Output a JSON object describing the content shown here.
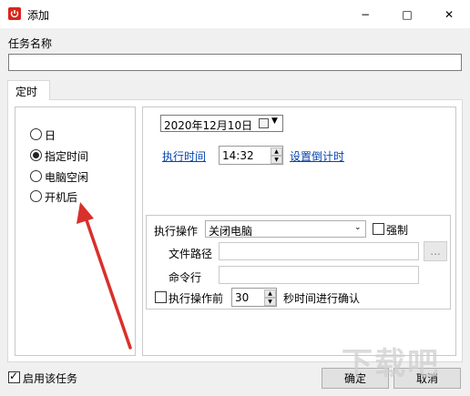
{
  "window": {
    "title": "添加",
    "controls": {
      "minimize": "−",
      "maximize": "□",
      "close": "✕"
    }
  },
  "task_name": {
    "label": "任务名称",
    "value": ""
  },
  "tab": {
    "label": "定时"
  },
  "schedule_options": [
    {
      "label": "日",
      "selected": false
    },
    {
      "label": "指定时间",
      "selected": true
    },
    {
      "label": "电脑空闲",
      "selected": false
    },
    {
      "label": "开机后",
      "selected": false
    }
  ],
  "date_picker": {
    "value": "2020年12月10日"
  },
  "exec_time": {
    "link": "执行时间",
    "value": "14:32",
    "countdown_link": "设置倒计时"
  },
  "action": {
    "label": "执行操作",
    "value": "关闭电脑",
    "force_label": "强制"
  },
  "file_path": {
    "label": "文件路径",
    "value": "",
    "browse": "..."
  },
  "command": {
    "label": "命令行",
    "value": ""
  },
  "confirm": {
    "label": "执行操作前",
    "seconds": "30",
    "suffix": "秒时间进行确认"
  },
  "enable_task": {
    "label": "启用该任务",
    "checked": true
  },
  "buttons": {
    "ok": "确定",
    "cancel": "取消"
  },
  "watermark": "下载吧"
}
